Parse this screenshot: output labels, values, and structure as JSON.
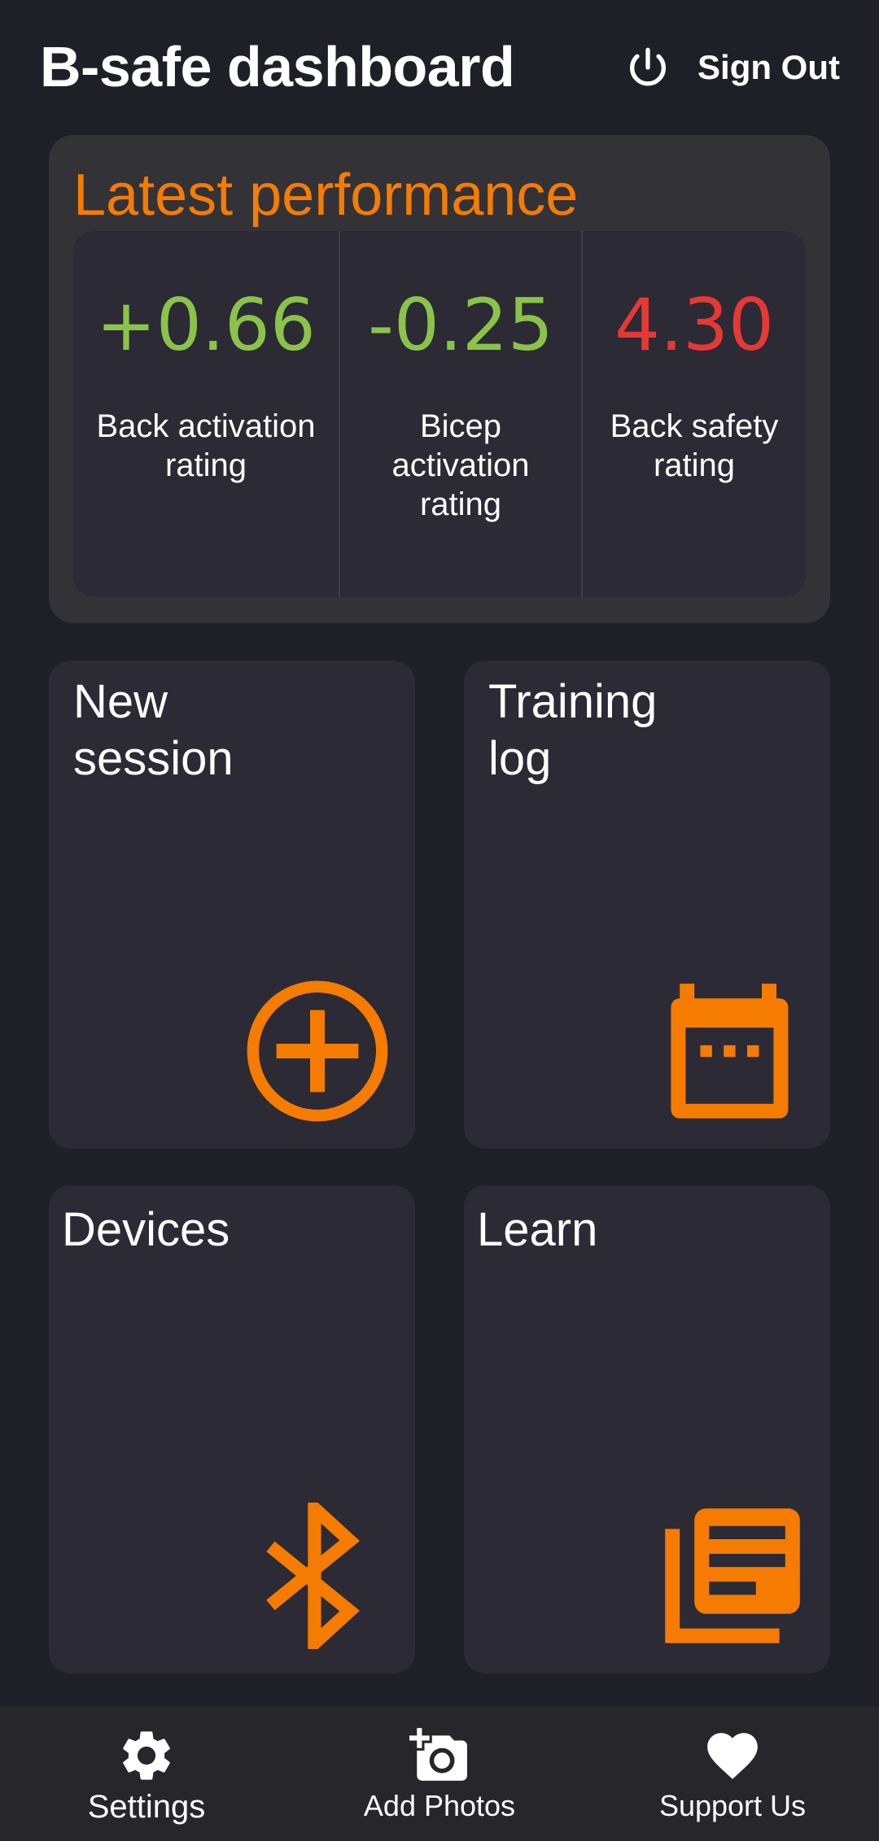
{
  "header": {
    "title": "B-safe dashboard",
    "signout_label": "Sign Out",
    "signout_icon": "power-icon"
  },
  "performance": {
    "title": "Latest performance",
    "metrics": [
      {
        "value": "+0.66",
        "label": "Back activation rating",
        "color": "#8bc34a"
      },
      {
        "value": "-0.25",
        "label": "Bicep activation rating",
        "color": "#8bc34a"
      },
      {
        "value": "4.30",
        "label": "Back safety rating",
        "color": "#e53935"
      }
    ]
  },
  "tiles": {
    "new_session": {
      "title": "New\nsession",
      "icon": "add-circle-icon"
    },
    "training_log": {
      "title": "Training\nlog",
      "icon": "calendar-icon"
    },
    "devices": {
      "title": "Devices",
      "icon": "bluetooth-icon"
    },
    "learn": {
      "title": "Learn",
      "icon": "library-books-icon"
    }
  },
  "bottom_nav": {
    "settings": {
      "label": "Settings",
      "icon": "gear-icon"
    },
    "add_photos": {
      "label": "Add Photos",
      "icon": "add-photo-icon"
    },
    "support": {
      "label": "Support Us",
      "icon": "heart-icon"
    }
  },
  "colors": {
    "accent": "#f57c00",
    "background": "#1f1f27",
    "card": "#2b2a35",
    "positive": "#8bc34a",
    "negative": "#e53935"
  }
}
